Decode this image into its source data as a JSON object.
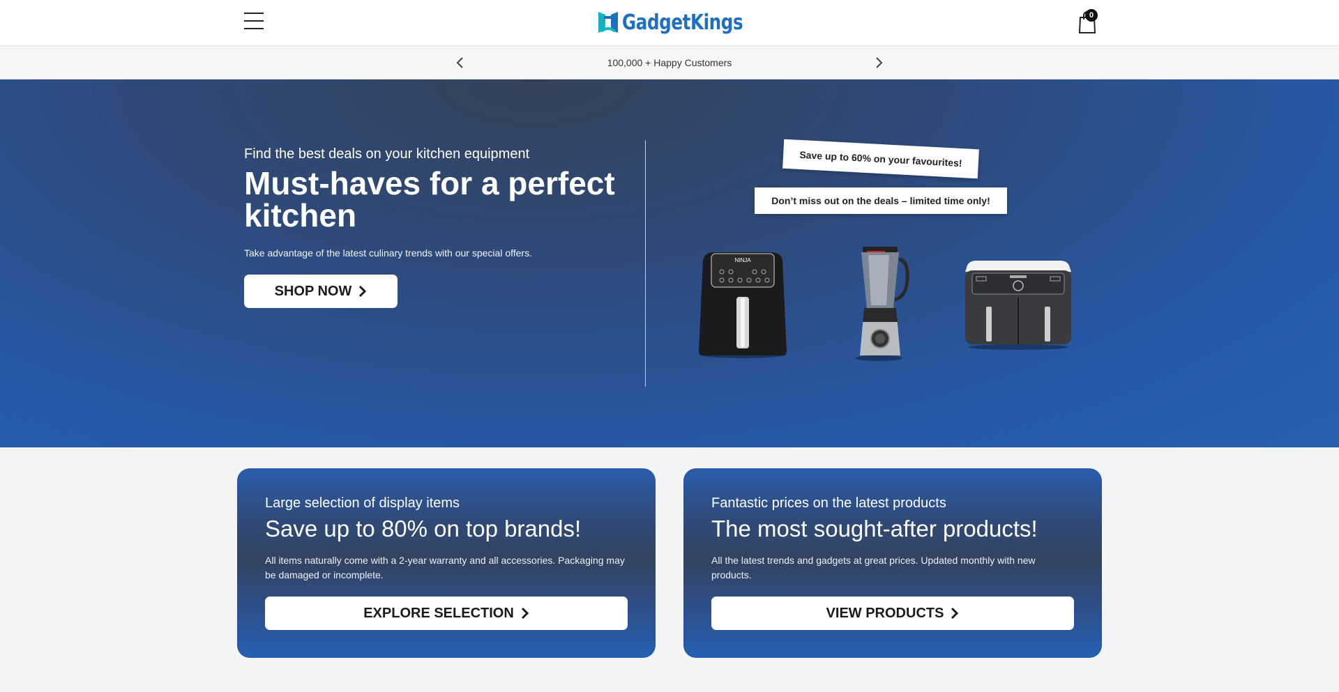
{
  "header": {
    "brand": "GadgetKings",
    "cart_count": "0",
    "brand_color": "#1e6fc0"
  },
  "announcement": {
    "text": "100,000 + Happy Customers"
  },
  "hero": {
    "subtitle": "Find the best deals on your kitchen equipment",
    "title": "Must-haves for a perfect kitchen",
    "description": "Take advantage of the latest culinary trends with our special offers.",
    "button_label": "SHOP NOW",
    "promo_primary": "Save up to 60% on your favourites!",
    "promo_secondary": "Don’t miss out on the deals – limited time only!"
  },
  "cards": [
    {
      "subtitle": "Large selection of display items",
      "title": "Save up to 80% on top brands!",
      "description": "All items naturally come with a 2-year warranty and all accessories. Packaging may be damaged or incomplete.",
      "button_label": "EXPLORE SELECTION"
    },
    {
      "subtitle": "Fantastic prices on the latest products",
      "title": "The most sought-after products!",
      "description": "All the latest trends and gadgets at great prices. Updated monthly with new products.",
      "button_label": "VIEW PRODUCTS"
    }
  ],
  "icons": {
    "menu": "hamburger-menu-icon",
    "cart": "shopping-bag-icon",
    "prev": "chevron-left-icon",
    "next": "chevron-right-icon",
    "button_arrow": "chevron-right-icon"
  },
  "colors": {
    "hero_blue": "#2659a8",
    "card_blue": "#2a5cab",
    "button_bg": "#ffffff"
  }
}
